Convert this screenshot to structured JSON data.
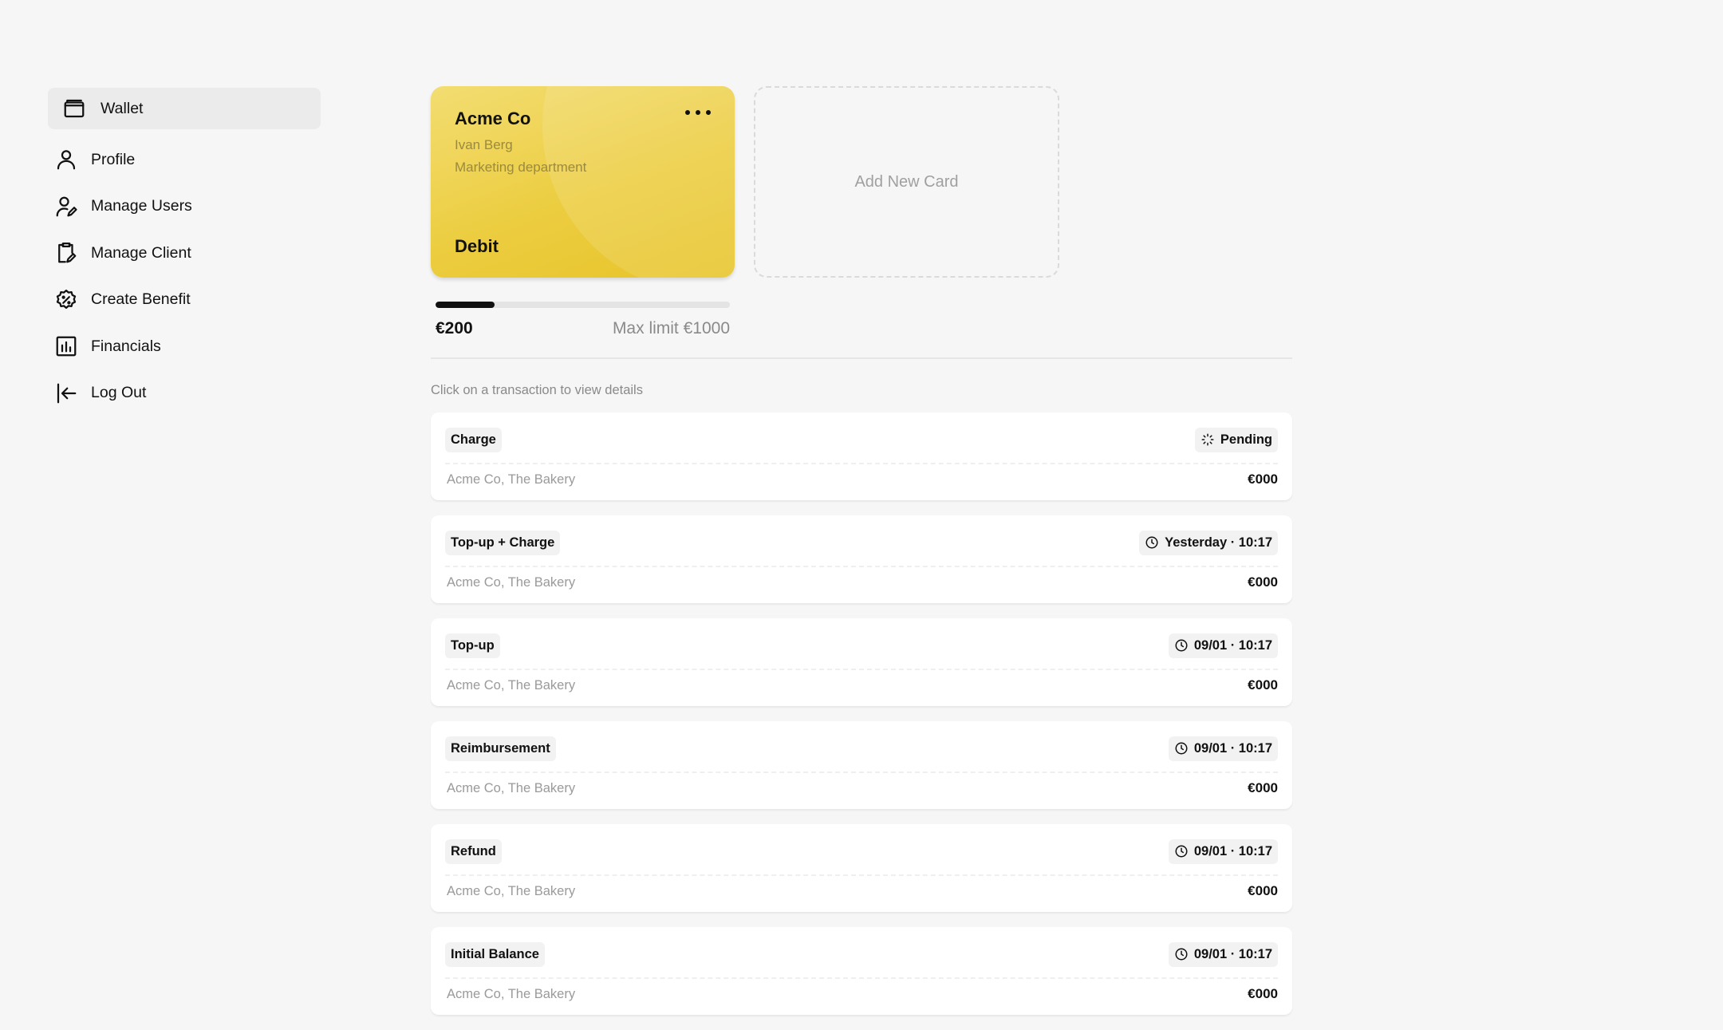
{
  "sidebar": {
    "items": [
      {
        "label": "Wallet",
        "icon": "wallet-icon"
      },
      {
        "label": "Profile",
        "icon": "user-icon"
      },
      {
        "label": "Manage Users",
        "icon": "user-edit-icon"
      },
      {
        "label": "Manage Client",
        "icon": "clipboard-edit-icon"
      },
      {
        "label": "Create Benefit",
        "icon": "discount-badge-icon"
      },
      {
        "label": "Financials",
        "icon": "bar-chart-icon"
      },
      {
        "label": "Log Out",
        "icon": "logout-icon"
      }
    ]
  },
  "card": {
    "company": "Acme Co",
    "holder": "Ivan Berg",
    "department": "Marketing department",
    "type": "Debit"
  },
  "add_card": {
    "label": "Add New Card"
  },
  "limit": {
    "current_label": "€200",
    "max_label": "Max limit €1000",
    "current": 200,
    "max": 1000
  },
  "transactions": {
    "hint": "Click on a transaction to view details",
    "items": [
      {
        "type": "Charge",
        "status": "Pending",
        "status_icon": "loading-spinner-icon",
        "merchant": "Acme Co, The Bakery",
        "amount": "€000"
      },
      {
        "type": "Top-up + Charge",
        "status": "Yesterday · 10:17",
        "status_icon": "clock-icon",
        "merchant": "Acme Co, The Bakery",
        "amount": "€000"
      },
      {
        "type": "Top-up",
        "status": "09/01 · 10:17",
        "status_icon": "clock-icon",
        "merchant": "Acme Co, The Bakery",
        "amount": "€000"
      },
      {
        "type": "Reimbursement",
        "status": "09/01 · 10:17",
        "status_icon": "clock-icon",
        "merchant": "Acme Co, The Bakery",
        "amount": "€000"
      },
      {
        "type": "Refund",
        "status": "09/01 · 10:17",
        "status_icon": "clock-icon",
        "merchant": "Acme Co, The Bakery",
        "amount": "€000"
      },
      {
        "type": "Initial Balance",
        "status": "09/01 · 10:17",
        "status_icon": "clock-icon",
        "merchant": "Acme Co, The Bakery",
        "amount": "€000"
      }
    ]
  }
}
